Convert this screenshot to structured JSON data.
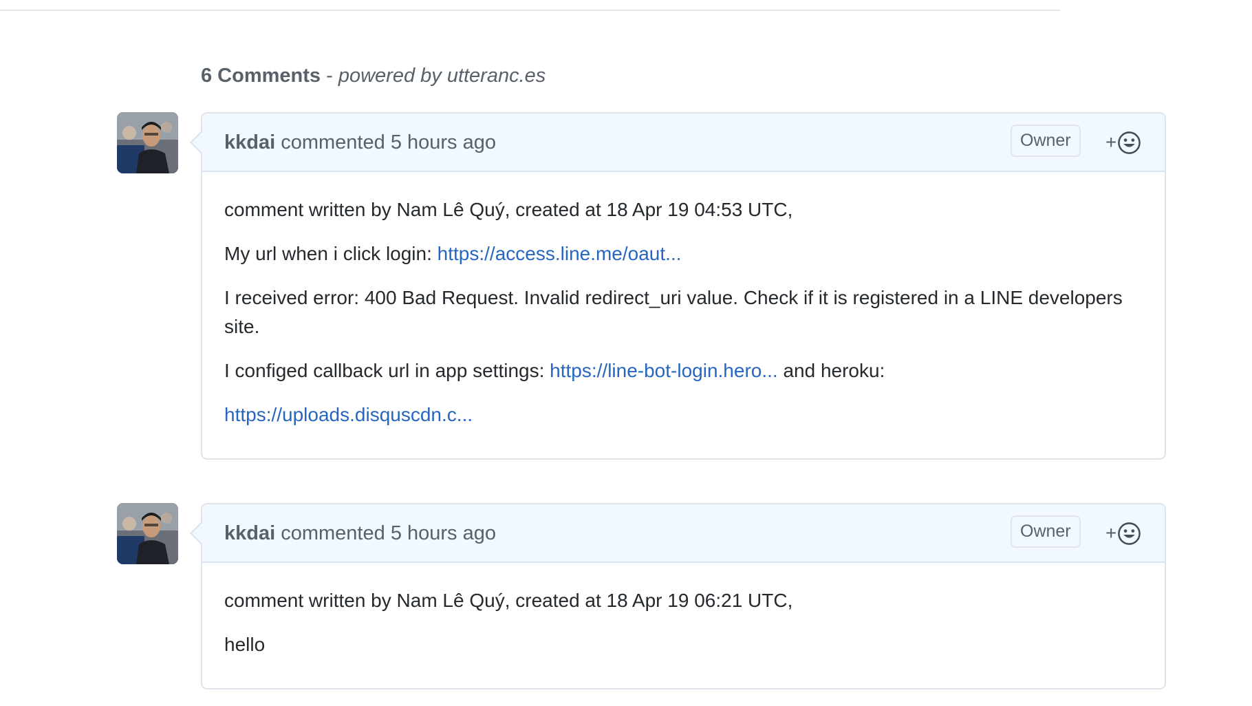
{
  "header": {
    "count": "6 Comments",
    "separator": " - ",
    "powered_by": "powered by utteranc.es"
  },
  "comments": [
    {
      "author": "kkdai",
      "action": " commented ",
      "time": "5 hours ago",
      "badge": "Owner",
      "reaction_label": "+",
      "paragraphs": [
        {
          "text": "comment written by Nam Lê Quý, created at 18 Apr 19 04:53 UTC,"
        },
        {
          "text": "My url when i click login: ",
          "link": "https://access.line.me/oaut..."
        },
        {
          "text": "I received error: 400 Bad Request. Invalid redirect_uri value. Check if it is registered in a LINE developers site."
        },
        {
          "text": "I configed callback url in app settings: ",
          "link": "https://line-bot-login.hero...",
          "after": " and heroku:"
        },
        {
          "link": "https://uploads.disquscdn.c..."
        }
      ]
    },
    {
      "author": "kkdai",
      "action": " commented ",
      "time": "5 hours ago",
      "badge": "Owner",
      "reaction_label": "+",
      "paragraphs": [
        {
          "text": "comment written by Nam Lê Quý, created at 18 Apr 19 06:21 UTC,"
        },
        {
          "text": "hello"
        }
      ]
    }
  ],
  "colors": {
    "link": "#2766c0",
    "header_bg": "#f1f8ff",
    "muted_text": "#586069"
  },
  "icons": {
    "reaction": "smiley-icon",
    "avatar": "user-avatar"
  }
}
